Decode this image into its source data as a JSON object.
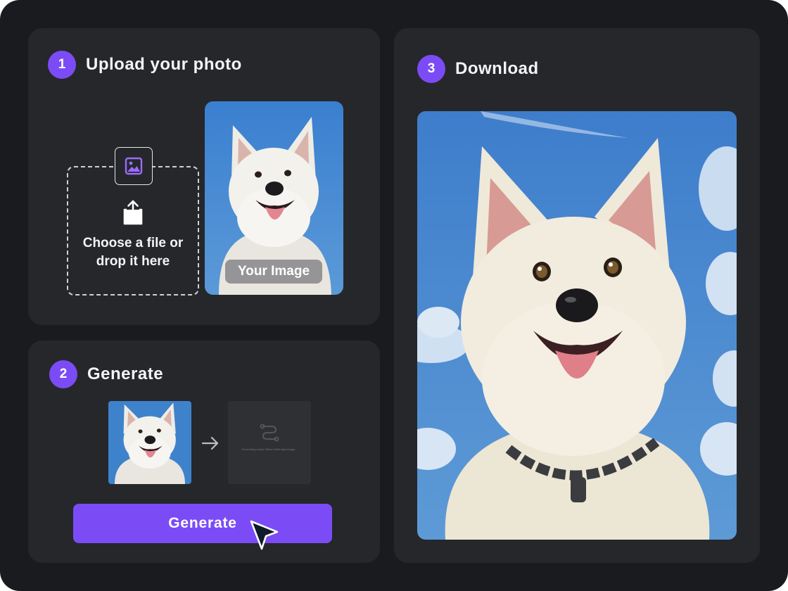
{
  "steps": {
    "upload": {
      "number": "1",
      "title": "Upload your photo"
    },
    "generate": {
      "number": "2",
      "title": "Generate"
    },
    "download": {
      "number": "3",
      "title": "Download"
    }
  },
  "upload": {
    "drop_text_line1": "Choose a file or",
    "drop_text_line2": "drop it here",
    "image_label": "Your Image"
  },
  "generate": {
    "button_label": "Generate",
    "loading_text": "Generating anime Shiba Ghibli style image..."
  },
  "colors": {
    "accent": "#7b4cf5",
    "frame_bg": "#1a1b1e",
    "card_bg": "#26272a",
    "sky_blue": "#3f82cc"
  },
  "icons": [
    "image-icon",
    "upload-icon",
    "arrow-right-icon",
    "loading-icon",
    "cursor-icon"
  ]
}
